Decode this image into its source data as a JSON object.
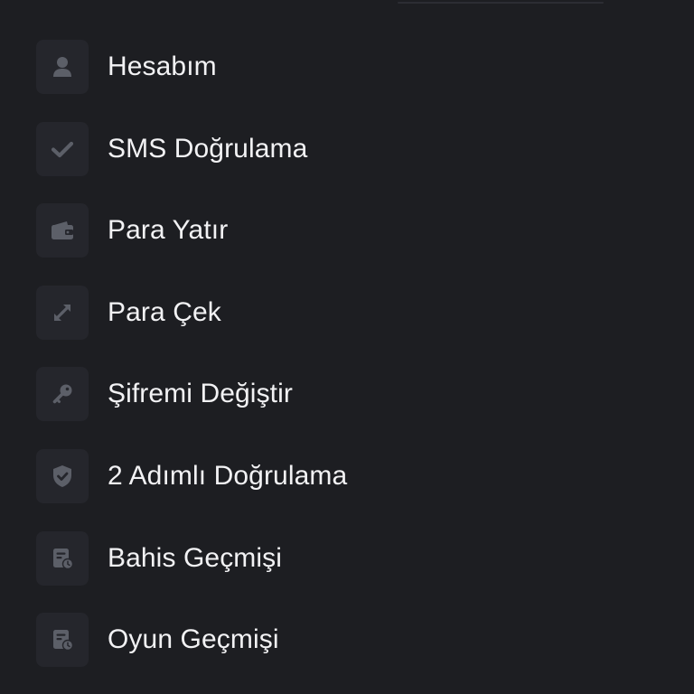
{
  "colors": {
    "background": "#1d1e22",
    "icon_tile": "#25262c",
    "icon": "#5c5f68",
    "text": "#f2f2f4"
  },
  "menu": {
    "items": [
      {
        "label": "Hesabım",
        "icon": "user-icon"
      },
      {
        "label": "SMS Doğrulama",
        "icon": "checkmark-icon"
      },
      {
        "label": "Para Yatır",
        "icon": "wallet-icon"
      },
      {
        "label": "Para Çek",
        "icon": "transfer-arrows-icon"
      },
      {
        "label": "Şifremi Değiştir",
        "icon": "key-icon"
      },
      {
        "label": "2 Adımlı Doğrulama",
        "icon": "shield-check-icon"
      },
      {
        "label": "Bahis Geçmişi",
        "icon": "history-document-icon"
      },
      {
        "label": "Oyun Geçmişi",
        "icon": "history-document-icon"
      }
    ]
  }
}
